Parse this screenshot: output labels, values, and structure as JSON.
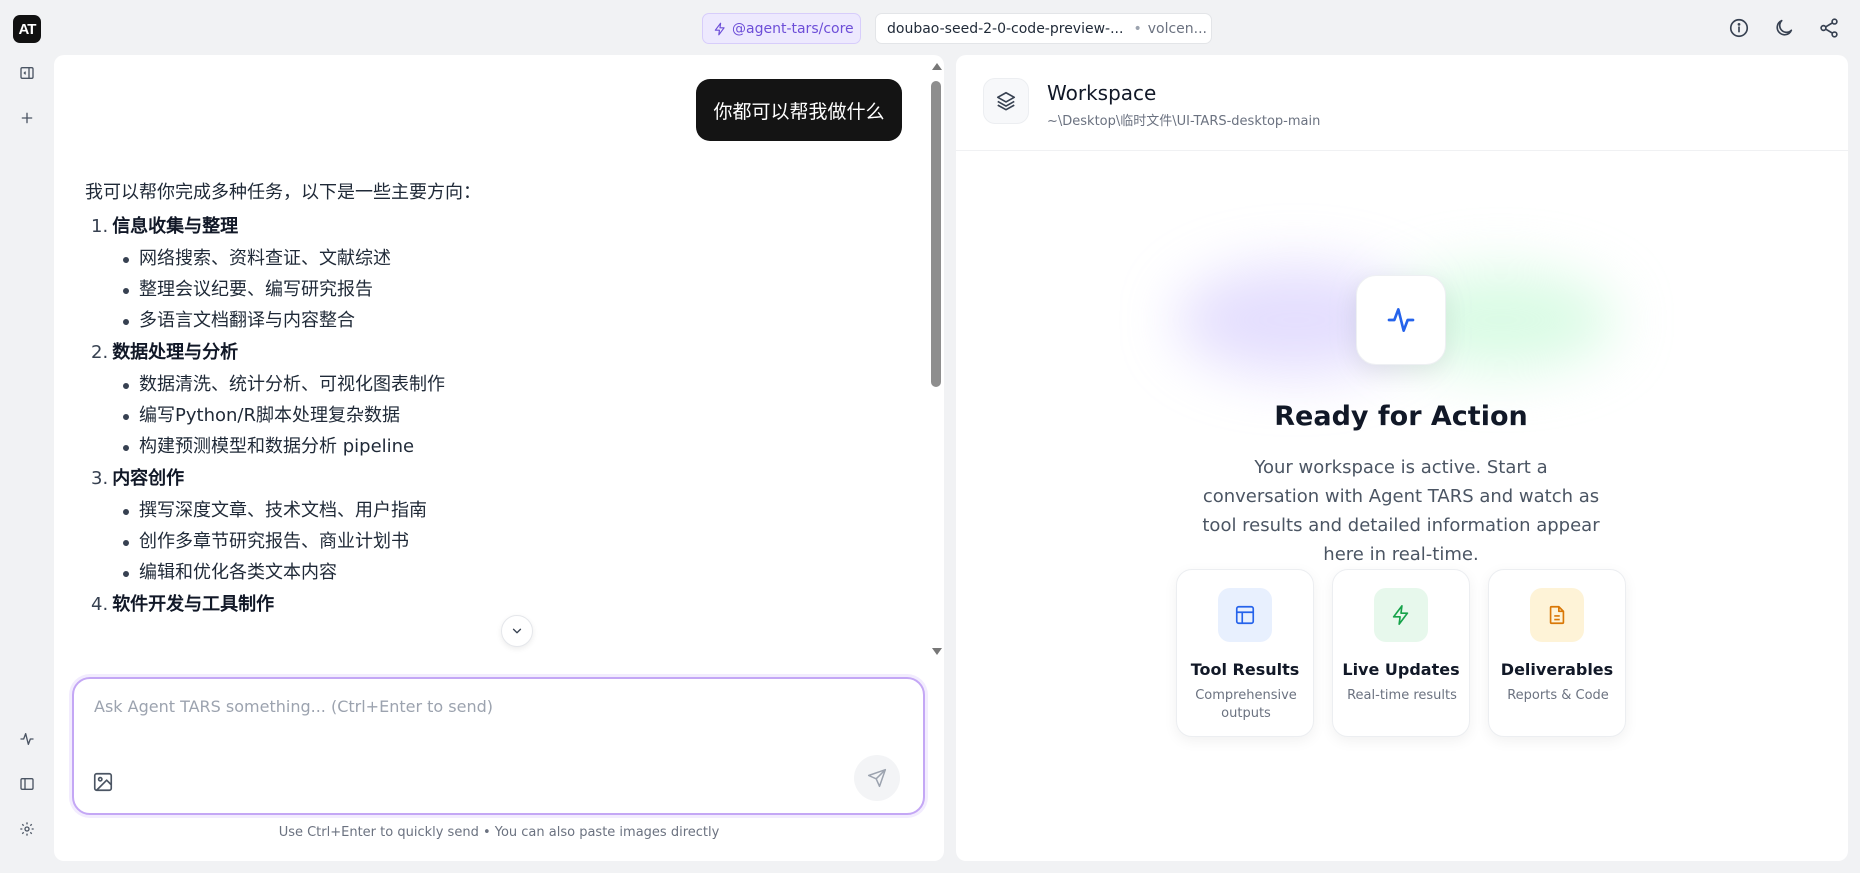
{
  "topbar": {
    "logo_text": "AT",
    "agent_label": "@agent-tars/core",
    "model_name": "doubao-seed-2-0-code-preview-...",
    "model_separator": "•",
    "model_provider": "volcen...",
    "icons": [
      "info-icon",
      "moon-icon",
      "share-icon"
    ]
  },
  "rail": {
    "top_icons": [
      "sidebar-toggle-icon",
      "plus-icon"
    ],
    "bottom_icons": [
      "activity-icon",
      "panel-icon",
      "settings-icon"
    ]
  },
  "chat": {
    "user_message": "你都可以帮我做什么",
    "assistant_intro": "我可以帮你完成多种任务，以下是一些主要方向：",
    "sections": [
      {
        "num": "1.",
        "title": "信息收集与整理",
        "items": [
          "网络搜索、资料查证、文献综述",
          "整理会议纪要、编写研究报告",
          "多语言文档翻译与内容整合"
        ]
      },
      {
        "num": "2.",
        "title": "数据处理与分析",
        "items": [
          "数据清洗、统计分析、可视化图表制作",
          "编写Python/R脚本处理复杂数据",
          "构建预测模型和数据分析 pipeline"
        ]
      },
      {
        "num": "3.",
        "title": "内容创作",
        "items": [
          "撰写深度文章、技术文档、用户指南",
          "创作多章节研究报告、商业计划书",
          "编辑和优化各类文本内容"
        ]
      },
      {
        "num": "4.",
        "title": "软件开发与工具制作",
        "items": []
      }
    ],
    "input_placeholder": "Ask Agent TARS something... (Ctrl+Enter to send)",
    "input_value": "",
    "hint": "Use Ctrl+Enter to quickly send • You can also paste images directly"
  },
  "workspace": {
    "title": "Workspace",
    "path": "~\\Desktop\\临时文件\\UI-TARS-desktop-main",
    "ready_title": "Ready for Action",
    "ready_desc": "Your workspace is active. Start a conversation with Agent TARS and watch as tool results and detailed information appear here in real-time.",
    "cards": [
      {
        "title": "Tool Results",
        "sub": "Comprehensive outputs",
        "icon": "layout-icon",
        "color": "#2563eb",
        "bg": "#e8f0fe"
      },
      {
        "title": "Live Updates",
        "sub": "Real-time results",
        "icon": "zap-icon",
        "color": "#16a34a",
        "bg": "#e7f8ec"
      },
      {
        "title": "Deliverables",
        "sub": "Reports & Code",
        "icon": "file-icon",
        "color": "#d97706",
        "bg": "#fef3d7"
      }
    ]
  }
}
